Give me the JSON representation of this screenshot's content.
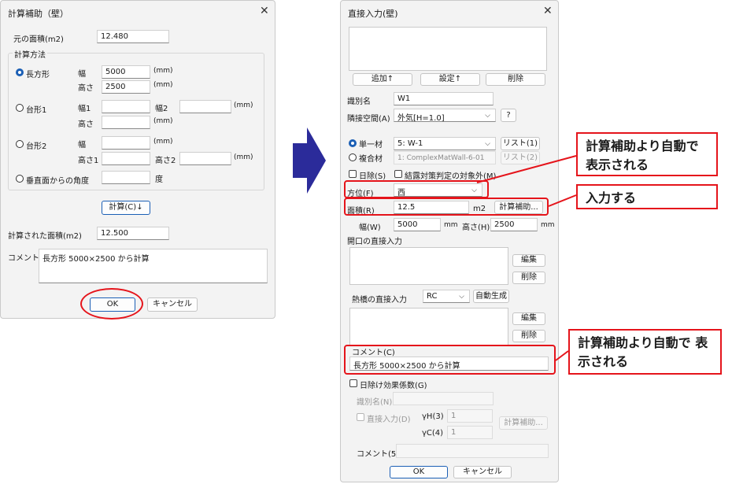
{
  "left": {
    "title": "計算補助（壁）",
    "orig_area_label": "元の面積(m2)",
    "orig_area_value": "12.480",
    "method_group": "計算方法",
    "rect_label": "長方形",
    "rect_width_label": "幅",
    "rect_width_value": "5000",
    "rect_height_label": "高さ",
    "rect_height_value": "2500",
    "unit_mm": "(mm)",
    "trap1_label": "台形1",
    "trap1_w1_label": "幅1",
    "trap1_w2_label": "幅2",
    "trap1_h_label": "高さ",
    "trap2_label": "台形2",
    "trap2_w_label": "幅",
    "trap2_h1_label": "高さ1",
    "trap2_h2_label": "高さ2",
    "angle_label": "垂直面からの角度",
    "angle_unit": "度",
    "calc_button": "計算(C)↓",
    "calc_area_label": "計算された面積(m2)",
    "calc_area_value": "12.500",
    "comment_label": "コメント",
    "comment_value": "長方形 5000×2500 から計算",
    "ok_button": "OK",
    "cancel_button": "キャンセル"
  },
  "right": {
    "title": "直接入力(壁)",
    "add_button": "追加↑",
    "set_button": "設定↑",
    "delete_button": "削除",
    "id_label": "識別名",
    "id_value": "W1",
    "adjacent_label": "隣接空間(A)",
    "adjacent_value": "外気[H=1.0]",
    "help_button": "?",
    "single_label": "単一材",
    "single_value": "5: W-1",
    "list1_button": "リスト(1)",
    "composite_label": "複合材",
    "composite_value": "1: ComplexMatWall-6-01",
    "list2_button": "リスト(2)",
    "sunshade_label": "日除(S)",
    "condensation_label": "結露対策判定の対象外(M)",
    "direction_label": "方位(F)",
    "direction_value": "西",
    "area_label": "面積(R)",
    "area_value": "12.5",
    "area_unit": "m2",
    "calc_assist_button": "計算補助...",
    "width_label": "幅(W)",
    "width_value": "5000",
    "mm1": "mm",
    "height_label": "高さ(H)",
    "height_value": "2500",
    "mm2": "mm",
    "opening_label": "開口の直接入力",
    "edit_button": "編集",
    "delete2_button": "削除",
    "thermal_label": "熱橋の直接入力",
    "thermal_value": "RC",
    "auto_gen_button": "自動生成",
    "edit2_button": "編集",
    "delete3_button": "削除",
    "comment_label": "コメント(C)",
    "comment_value": "長方形 5000×2500 から計算",
    "sunshade_effect_label": "日除け効果係数(G)",
    "id2_label": "識別名(N)",
    "direct_input_label": "直接入力(D)",
    "gh_label": "γH(3)",
    "gh_value": "1",
    "gc_label": "γC(4)",
    "gc_value": "1",
    "calc_assist2_button": "計算補助...",
    "comment2_label": "コメント(5)",
    "ok_button": "OK",
    "cancel_button": "キャンセル"
  },
  "callouts": {
    "c1": "計算補助より自動で 表示される",
    "c2": "入力する",
    "c3": "計算補助より自動で 表示される"
  },
  "colors": {
    "annotation_red": "#e5141b",
    "arrow_blue": "#2b2b9a",
    "accent": "#1b5fb5"
  }
}
